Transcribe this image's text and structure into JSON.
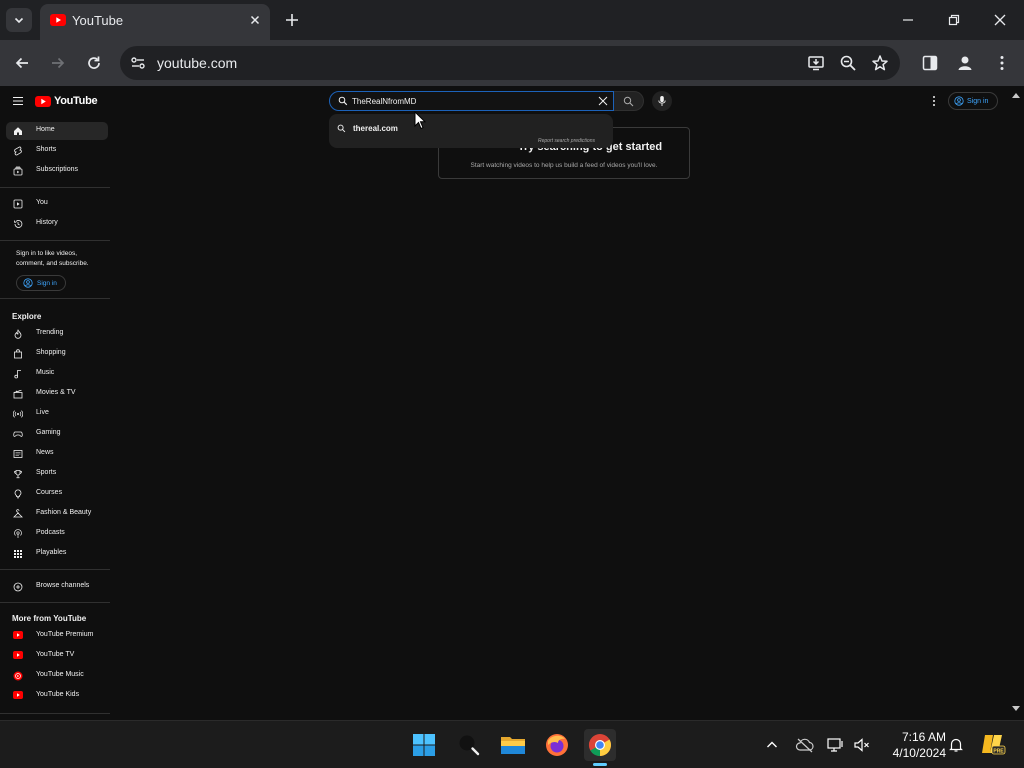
{
  "browser": {
    "tab_title": "YouTube",
    "url": "youtube.com"
  },
  "youtube": {
    "logo_text": "YouTube",
    "search_value": "TheRealNfromMD",
    "suggestion": "thereal.com",
    "report_text": "Report search predictions",
    "prompt_title": "Try searching to get started",
    "prompt_sub": "Start watching videos to help us build a feed of videos you'll love.",
    "signin_label": "Sign in",
    "sidebar": {
      "home": "Home",
      "shorts": "Shorts",
      "subscriptions": "Subscriptions",
      "you": "You",
      "history": "History",
      "signin_text": "Sign in to like videos, comment, and subscribe.",
      "signin_button": "Sign in",
      "explore_heading": "Explore",
      "explore": [
        "Trending",
        "Shopping",
        "Music",
        "Movies & TV",
        "Live",
        "Gaming",
        "News",
        "Sports",
        "Courses",
        "Fashion & Beauty",
        "Podcasts",
        "Playables"
      ],
      "browse_channels": "Browse channels",
      "more_heading": "More from YouTube",
      "more": [
        "YouTube Premium",
        "YouTube TV",
        "YouTube Music",
        "YouTube Kids"
      ]
    }
  },
  "taskbar": {
    "time": "7:16 AM",
    "date": "4/10/2024"
  },
  "colors": {
    "yt_red": "#ff0000",
    "link_blue": "#3ea6ff",
    "focus_blue": "#1c62b9"
  }
}
